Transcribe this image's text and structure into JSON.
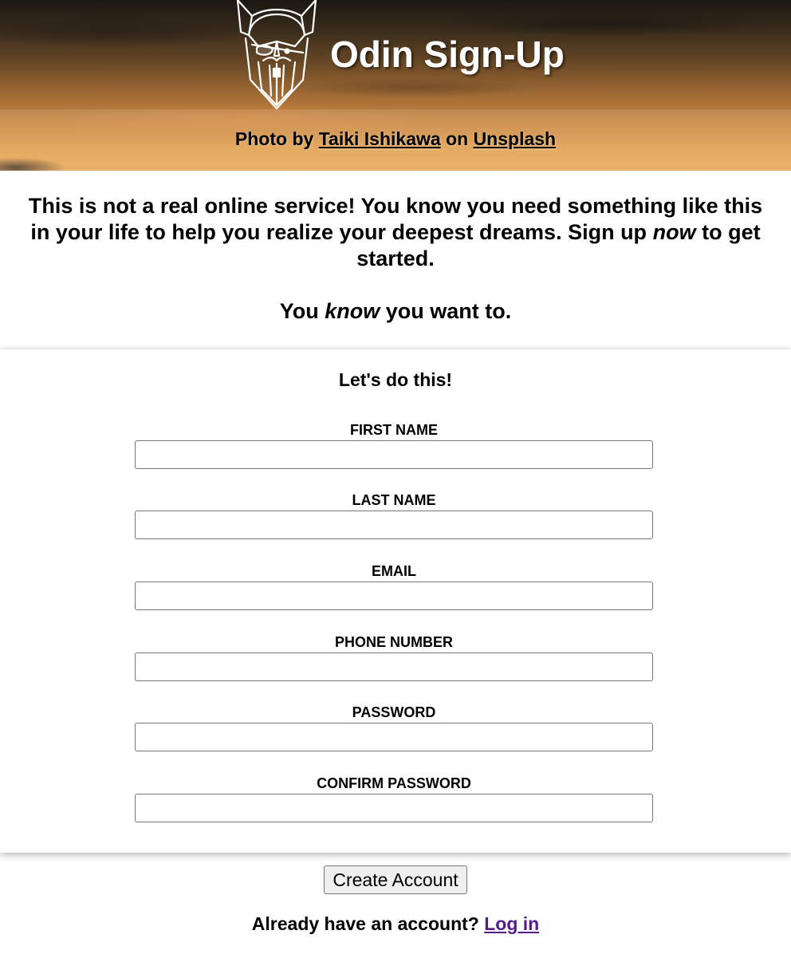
{
  "header": {
    "title": "Odin Sign-Up",
    "logo_icon": "viking-helmet-logo-icon",
    "credit_prefix": "Photo by",
    "credit_author": "Taiki Ishikawa",
    "credit_mid": "on",
    "credit_site": "Unsplash"
  },
  "intro": {
    "line1_before": "This is not a real online service! You know you need something like this in your life to help you realize your deepest dreams. Sign up",
    "line1_em": "now",
    "line1_after": "to get started.",
    "line2_before": "You",
    "line2_em": "know",
    "line2_after": "you want to."
  },
  "form": {
    "heading": "Let's do this!",
    "fields": [
      {
        "label": "FIRST NAME",
        "value": ""
      },
      {
        "label": "LAST NAME",
        "value": ""
      },
      {
        "label": "EMAIL",
        "value": ""
      },
      {
        "label": "PHONE NUMBER",
        "value": ""
      },
      {
        "label": "PASSWORD",
        "value": ""
      },
      {
        "label": "CONFIRM PASSWORD",
        "value": ""
      }
    ],
    "submit_label": "Create Account"
  },
  "footer": {
    "login_prompt": "Already have an account?",
    "login_link": "Log in"
  },
  "colors": {
    "link_visited": "#551a8b",
    "header_text": "#ffffff"
  }
}
